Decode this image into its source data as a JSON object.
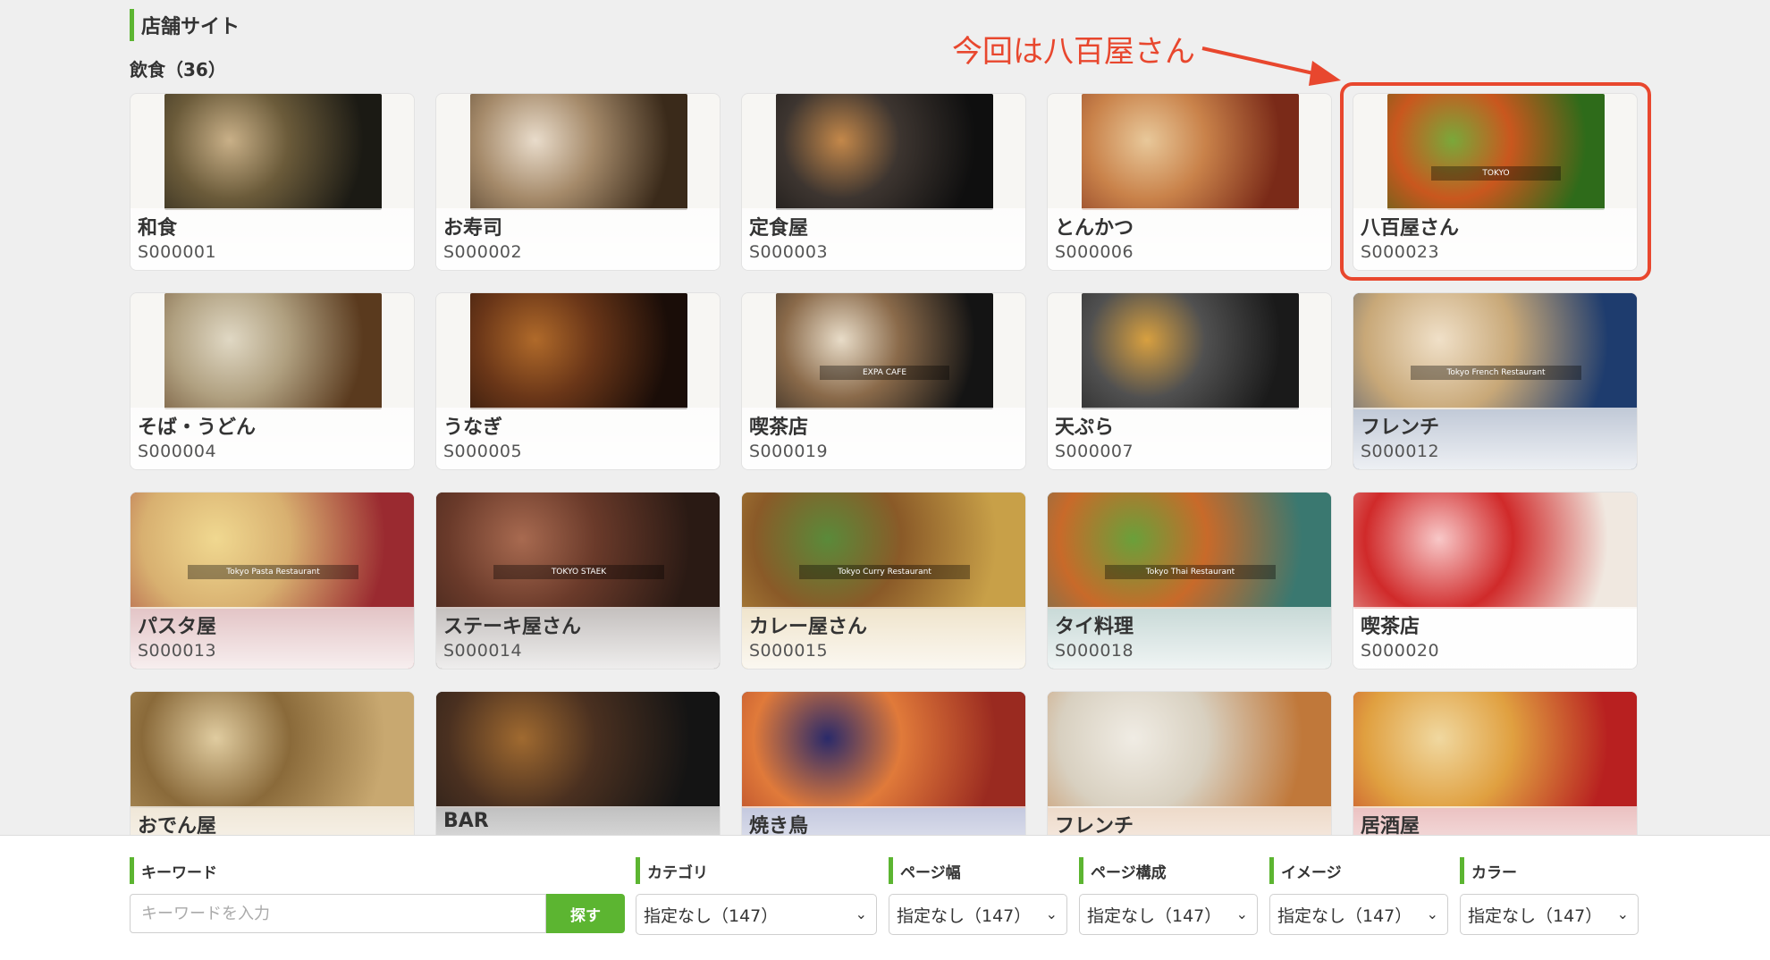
{
  "section_title": "店舗サイト",
  "category_title": "飲食（36）",
  "annotation": {
    "text": "今回は八百屋さん",
    "color": "#e8472e"
  },
  "accent_color": "#5cb531",
  "cards": [
    {
      "name": "和食",
      "code": "S000001",
      "thumb_text": "",
      "colors": [
        "#1b1a14",
        "#6b5b3a",
        "#c9b088"
      ],
      "wide": false,
      "bg": "#f7f6f3"
    },
    {
      "name": "お寿司",
      "code": "S000002",
      "thumb_text": "",
      "colors": [
        "#3a2a1a",
        "#a58a6a",
        "#e9dccb"
      ],
      "wide": false,
      "bg": "#f7f6f3"
    },
    {
      "name": "定食屋",
      "code": "S000003",
      "thumb_text": "",
      "colors": [
        "#0f0f0f",
        "#3d3530",
        "#c4884a"
      ],
      "wide": false,
      "bg": "#f7f6f3"
    },
    {
      "name": "とんかつ",
      "code": "S000006",
      "thumb_text": "",
      "colors": [
        "#7a2a18",
        "#c9824a",
        "#e8c89a"
      ],
      "wide": false,
      "bg": "#f7f6f3"
    },
    {
      "name": "八百屋さん",
      "code": "S000023",
      "thumb_text": "TOKYO",
      "colors": [
        "#2e6b1a",
        "#c9571e",
        "#7aa83a"
      ],
      "wide": false,
      "bg": "#f7f6f3"
    },
    {
      "name": "そば・うどん",
      "code": "S000004",
      "thumb_text": "",
      "colors": [
        "#5a3a1e",
        "#b0a080",
        "#e0d8c4"
      ],
      "wide": false,
      "bg": "#f7f6f3"
    },
    {
      "name": "うなぎ",
      "code": "S000005",
      "thumb_text": "",
      "colors": [
        "#1a0d08",
        "#6a3618",
        "#b06a2a"
      ],
      "wide": false,
      "bg": "#f7f6f3"
    },
    {
      "name": "喫茶店",
      "code": "S000019",
      "thumb_text": "EXPA CAFE",
      "colors": [
        "#141414",
        "#8a6a4a",
        "#e8dcc8"
      ],
      "wide": false,
      "bg": "#f7f6f3"
    },
    {
      "name": "天ぷら",
      "code": "S000007",
      "thumb_text": "",
      "colors": [
        "#1a1a1a",
        "#505050",
        "#d8a040"
      ],
      "wide": false,
      "bg": "#f7f6f3"
    },
    {
      "name": "フレンチ",
      "code": "S000012",
      "thumb_text": "Tokyo French Restaurant",
      "colors": [
        "#1e3c6e",
        "#c8a878",
        "#f0e0c8"
      ],
      "wide": true,
      "bg": "#1e3c6e"
    },
    {
      "name": "パスタ屋",
      "code": "S000013",
      "thumb_text": "Tokyo Pasta Restaurant",
      "colors": [
        "#9a2a30",
        "#d8b070",
        "#f0d890"
      ],
      "wide": true,
      "bg": "#9a2a30"
    },
    {
      "name": "ステーキ屋さん",
      "code": "S000014",
      "thumb_text": "TOKYO STAEK",
      "colors": [
        "#2a1a14",
        "#6a3a2a",
        "#a86a50"
      ],
      "wide": true,
      "bg": "#2a1a14"
    },
    {
      "name": "カレー屋さん",
      "code": "S000015",
      "thumb_text": "Tokyo Curry Restaurant",
      "colors": [
        "#c8a048",
        "#8a5a28",
        "#5a8a3a"
      ],
      "wide": true,
      "bg": "#c8a048"
    },
    {
      "name": "タイ料理",
      "code": "S000018",
      "thumb_text": "Tokyo Thai Restaurant",
      "colors": [
        "#3a7870",
        "#c86a2a",
        "#6aa03a"
      ],
      "wide": true,
      "bg": "#3a7870"
    },
    {
      "name": "喫茶店",
      "code": "S000020",
      "thumb_text": "",
      "colors": [
        "#f0e8e0",
        "#d02a2a",
        "#f8c8c8"
      ],
      "wide": true,
      "bg": "#fafafa"
    },
    {
      "name": "おでん屋",
      "code": "",
      "thumb_text": "",
      "colors": [
        "#c8a870",
        "#8a6a3a",
        "#e0cca0"
      ],
      "wide": true,
      "bg": "#c8a870"
    },
    {
      "name": "BAR",
      "code": "",
      "thumb_text": "",
      "colors": [
        "#141414",
        "#4a3020",
        "#a06a30"
      ],
      "wide": true,
      "bg": "#1a1a1a"
    },
    {
      "name": "焼き鳥",
      "code": "",
      "thumb_text": "",
      "colors": [
        "#9a2a20",
        "#e07a3a",
        "#2a2a6a"
      ],
      "wide": true,
      "bg": "#2a3a8a"
    },
    {
      "name": "フレンチ",
      "code": "",
      "thumb_text": "",
      "colors": [
        "#c0783a",
        "#d8d0c0",
        "#f0ece4"
      ],
      "wide": true,
      "bg": "#c0783a"
    },
    {
      "name": "居酒屋",
      "code": "",
      "thumb_text": "",
      "colors": [
        "#b82020",
        "#e0a040",
        "#f0d8a0"
      ],
      "wide": true,
      "bg": "#b82020"
    }
  ],
  "filters": {
    "keyword_label": "キーワード",
    "keyword_placeholder": "キーワードを入力",
    "search_button": "探す",
    "category_label": "カテゴリ",
    "category_value": "指定なし（147）",
    "width_label": "ページ幅",
    "width_value": "指定なし（147）",
    "structure_label": "ページ構成",
    "structure_value": "指定なし（147）",
    "image_label": "イメージ",
    "image_value": "指定なし（147）",
    "color_label": "カラー",
    "color_value": "指定なし（147）"
  }
}
